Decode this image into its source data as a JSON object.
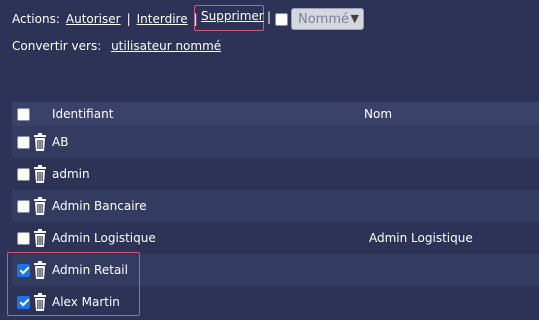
{
  "actions": {
    "label": "Actions:",
    "authorize": "Autoriser",
    "sep1": "|",
    "forbid": "Interdire",
    "sep2": "|",
    "delete": "Supprimer",
    "sep3": "|",
    "select_value": "Nommé"
  },
  "convert": {
    "label": "Convertir vers:",
    "link": "utilisateur nommé"
  },
  "table": {
    "headers": {
      "ident": "Identifiant",
      "nom": "Nom"
    },
    "rows": [
      {
        "ident": "AB",
        "nom": "",
        "checked": false
      },
      {
        "ident": "admin",
        "nom": "",
        "checked": false
      },
      {
        "ident": "Admin Bancaire",
        "nom": "",
        "checked": false
      },
      {
        "ident": "Admin Logistique",
        "nom": "Admin Logistique",
        "checked": false
      },
      {
        "ident": "Admin Retail",
        "nom": "",
        "checked": true
      },
      {
        "ident": "Alex Martin",
        "nom": "",
        "checked": true
      }
    ]
  },
  "colors": {
    "background": "#2c3356",
    "highlight": "#d4587a",
    "checkbox_checked": "#1a73e8"
  },
  "icons": {
    "row_action": "trash-icon"
  }
}
